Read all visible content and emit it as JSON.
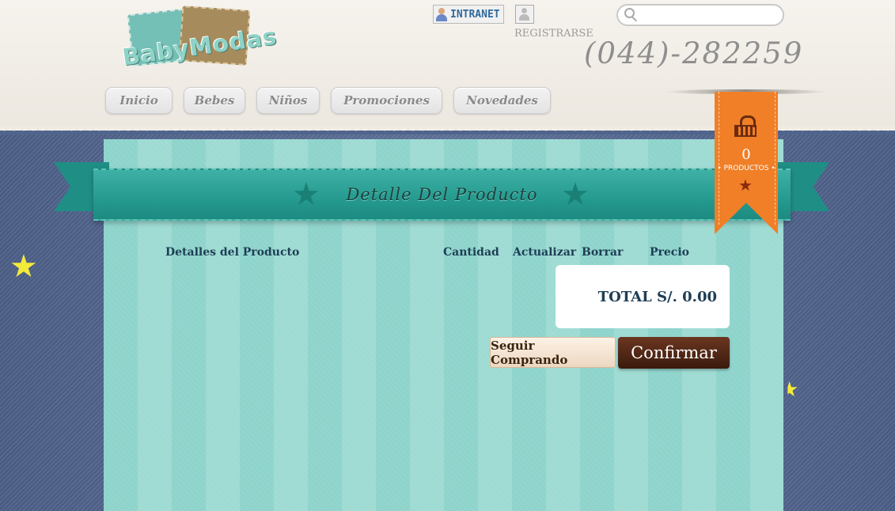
{
  "header": {
    "logo_text": "BabyModas",
    "intranet_label": "INTRANET",
    "registrarse_label": "REGISTRARSE",
    "phone": "(044)-282259",
    "search": {
      "placeholder": "",
      "value": ""
    }
  },
  "nav": {
    "items": [
      {
        "label": "Inicio"
      },
      {
        "label": "Bebes"
      },
      {
        "label": "Niños"
      },
      {
        "label": "Promociones"
      },
      {
        "label": "Novedades"
      }
    ]
  },
  "cart": {
    "count": "0",
    "label": "PRODUCTOS"
  },
  "section": {
    "title": "Detalle Del Producto"
  },
  "table": {
    "headers": {
      "details": "Detalles del Producto",
      "quantity": "Cantidad",
      "update": "Actualizar",
      "delete": "Borrar",
      "price": "Precio"
    }
  },
  "summary": {
    "total": "TOTAL S/. 0.00"
  },
  "actions": {
    "continue_label": "Seguir Comprando",
    "confirm_label": "Confirmar"
  },
  "colors": {
    "accent_teal": "#259a8f",
    "cart_orange": "#f07f27",
    "confirm_brown": "#4e2514",
    "denim": "#51648d"
  }
}
